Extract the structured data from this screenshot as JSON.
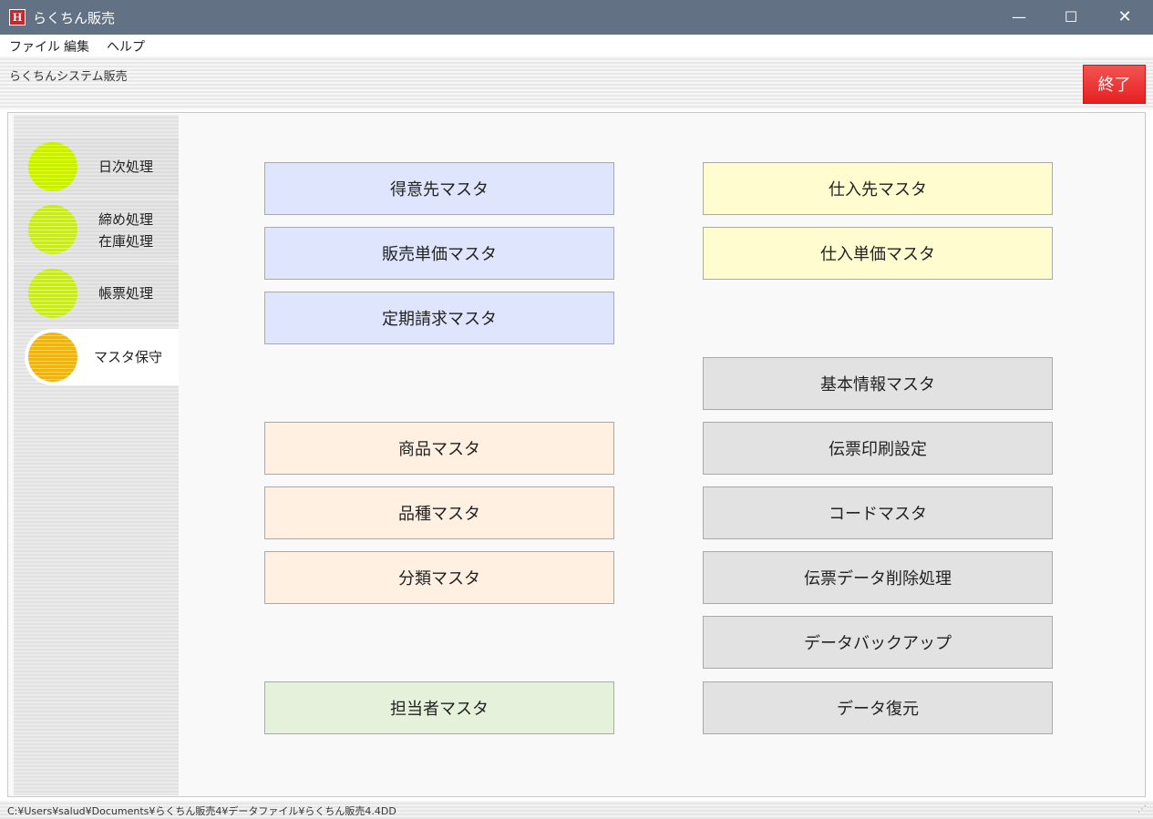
{
  "window": {
    "icon_text": "H",
    "title": "らくちん販売",
    "controls": {
      "minimize": "—",
      "maximize": "☐",
      "close": "✕"
    }
  },
  "menu": [
    "ファイル",
    "編集",
    "ヘルプ"
  ],
  "header": {
    "system_title": "らくちんシステム販売",
    "exit_label": "終了",
    "exit_color": "#e62020"
  },
  "sidebar": {
    "items": [
      {
        "label": "日次処理",
        "lamp_color": "#c9f000",
        "active": false
      },
      {
        "label": "締め処理\n在庫処理",
        "lines": [
          "締め処理",
          "在庫処理"
        ],
        "lamp_color": "#c9f000",
        "active": false
      },
      {
        "label": "帳票処理",
        "lamp_color": "#c9f000",
        "active": false
      },
      {
        "label": "マスタ保守",
        "lamp_color": "#f6b400",
        "active": true
      }
    ]
  },
  "buttons": {
    "left": {
      "customer_master": "得意先マスタ",
      "sales_price_master": "販売単価マスタ",
      "periodic_billing_master": "定期請求マスタ",
      "product_master": "商品マスタ",
      "variety_master": "品種マスタ",
      "category_master": "分類マスタ",
      "staff_master": "担当者マスタ"
    },
    "right": {
      "supplier_master": "仕入先マスタ",
      "purchase_price_master": "仕入単価マスタ",
      "basic_info_master": "基本情報マスタ",
      "slip_print_settings": "伝票印刷設定",
      "code_master": "コードマスタ",
      "slip_data_delete": "伝票データ削除処理",
      "data_backup": "データバックアップ",
      "data_restore": "データ復元"
    }
  },
  "status": {
    "path": "C:¥Users¥salud¥Documents¥らくちん販売4¥データファイル¥らくちん販売4.4DD",
    "grip": "⋰"
  }
}
